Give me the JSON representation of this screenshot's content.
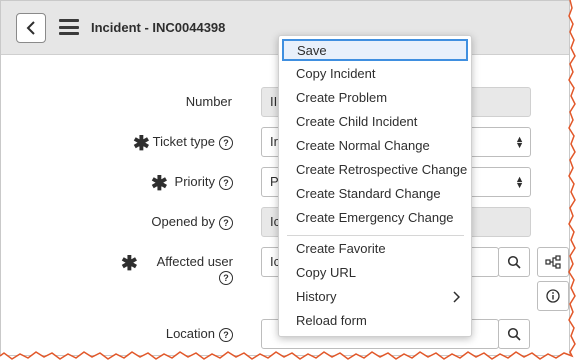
{
  "header": {
    "title": "Incident - INC0044398"
  },
  "form": {
    "number_label": "Number",
    "number_value": "II",
    "ticket_type_label": "Ticket type",
    "ticket_type_value": "Ir",
    "priority_label": "Priority",
    "priority_value": "P",
    "opened_by_label": "Opened by",
    "opened_by_value": "Ic",
    "affected_user_label": "Affected user",
    "affected_user_value": "Ic",
    "location_label": "Location",
    "help_glyph": "?"
  },
  "menu": {
    "items": [
      {
        "label": "Save"
      },
      {
        "label": "Copy Incident"
      },
      {
        "label": "Create Problem"
      },
      {
        "label": "Create Child Incident"
      },
      {
        "label": "Create Normal Change"
      },
      {
        "label": "Create Retrospective Change"
      },
      {
        "label": "Create Standard Change"
      },
      {
        "label": "Create Emergency Change"
      },
      {
        "label": "Create Favorite"
      },
      {
        "label": "Copy URL"
      },
      {
        "label": "History"
      },
      {
        "label": "Reload form"
      }
    ]
  },
  "colors": {
    "accent": "#3f8fe0",
    "torn_edge": "#e2582a"
  }
}
